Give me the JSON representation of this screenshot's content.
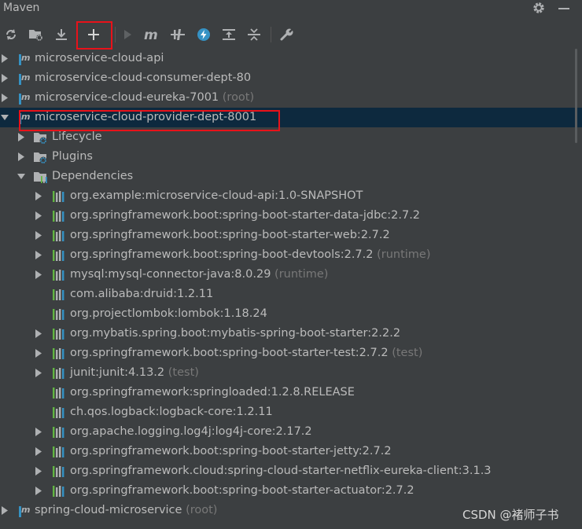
{
  "panel": {
    "title": "Maven"
  },
  "toolbar": {
    "buttons": [
      {
        "name": "reimport-icon"
      },
      {
        "name": "generate-sources-icon"
      },
      {
        "name": "download-icon"
      },
      {
        "name": "add-maven-project-icon"
      },
      {
        "name": "run-icon"
      },
      {
        "name": "execute-goal-icon"
      },
      {
        "name": "toggle-offline-icon"
      },
      {
        "name": "skip-tests-icon"
      },
      {
        "name": "show-dependencies-icon"
      },
      {
        "name": "collapse-all-icon"
      },
      {
        "name": "settings-wrench-icon"
      }
    ]
  },
  "tree": {
    "projects": [
      {
        "label": "microservice-cloud-api",
        "scope": ""
      },
      {
        "label": "microservice-cloud-consumer-dept-80",
        "scope": ""
      },
      {
        "label": "microservice-cloud-eureka-7001",
        "scope": "(root)"
      },
      {
        "label": "microservice-cloud-provider-dept-8001",
        "scope": ""
      },
      {
        "label": "spring-cloud-microservice",
        "scope": "(root)"
      }
    ],
    "folders": [
      {
        "label": "Lifecycle"
      },
      {
        "label": "Plugins"
      },
      {
        "label": "Dependencies"
      }
    ],
    "dependencies": [
      {
        "label": "org.example:microservice-cloud-api:1.0-SNAPSHOT",
        "scope": "",
        "expandable": true
      },
      {
        "label": "org.springframework.boot:spring-boot-starter-data-jdbc:2.7.2",
        "scope": "",
        "expandable": true
      },
      {
        "label": "org.springframework.boot:spring-boot-starter-web:2.7.2",
        "scope": "",
        "expandable": true
      },
      {
        "label": "org.springframework.boot:spring-boot-devtools:2.7.2",
        "scope": "(runtime)",
        "expandable": true
      },
      {
        "label": "mysql:mysql-connector-java:8.0.29",
        "scope": "(runtime)",
        "expandable": true
      },
      {
        "label": "com.alibaba:druid:1.2.11",
        "scope": "",
        "expandable": false
      },
      {
        "label": "org.projectlombok:lombok:1.18.24",
        "scope": "",
        "expandable": false
      },
      {
        "label": "org.mybatis.spring.boot:mybatis-spring-boot-starter:2.2.2",
        "scope": "",
        "expandable": true
      },
      {
        "label": "org.springframework.boot:spring-boot-starter-test:2.7.2",
        "scope": "(test)",
        "expandable": true
      },
      {
        "label": "junit:junit:4.13.2",
        "scope": "(test)",
        "expandable": true
      },
      {
        "label": "org.springframework:springloaded:1.2.8.RELEASE",
        "scope": "",
        "expandable": false
      },
      {
        "label": "ch.qos.logback:logback-core:1.2.11",
        "scope": "",
        "expandable": false
      },
      {
        "label": "org.apache.logging.log4j:log4j-core:2.17.2",
        "scope": "",
        "expandable": true
      },
      {
        "label": "org.springframework.boot:spring-boot-starter-jetty:2.7.2",
        "scope": "",
        "expandable": true
      },
      {
        "label": "org.springframework.cloud:spring-cloud-starter-netflix-eureka-client:3.1.3",
        "scope": "",
        "expandable": true
      },
      {
        "label": "org.springframework.boot:spring-boot-starter-actuator:2.7.2",
        "scope": "",
        "expandable": true
      }
    ]
  },
  "watermark": {
    "text": "CSDN @褚师子书"
  },
  "colors": {
    "background": "#3c3f41",
    "selection": "#0d293e",
    "highlight": "#e8121a",
    "text": "#bbbbbb",
    "scope_text": "#787878",
    "blue_icon": "#3592c4",
    "green_icon": "#62b543"
  }
}
